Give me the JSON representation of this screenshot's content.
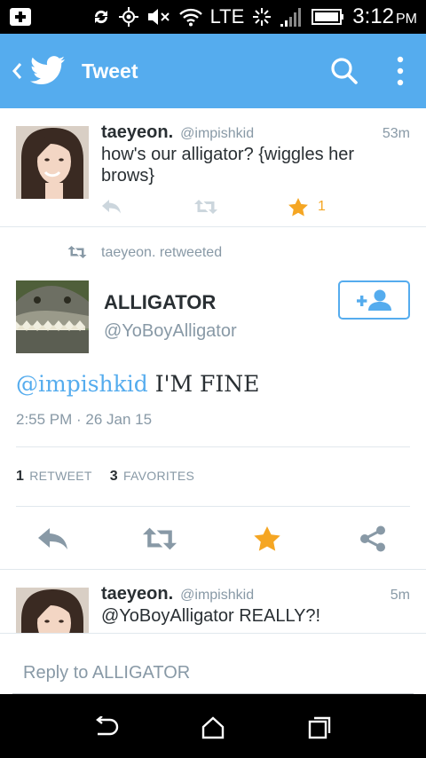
{
  "status_bar": {
    "network": "LTE",
    "time": "3:12",
    "ampm": "PM"
  },
  "app_bar": {
    "title": "Tweet",
    "icons": [
      "back-chevron-icon",
      "twitter-bird-icon",
      "search-icon",
      "overflow-menu-icon"
    ]
  },
  "tweets": {
    "t1": {
      "name": "taeyeon.",
      "handle": "@impishkid",
      "time": "53m",
      "text": "how's our alligator? {wiggles her brows}",
      "favorite_count": "1"
    },
    "main": {
      "retweeted_by": "taeyeon. retweeted",
      "name": "ALLIGATOR",
      "handle": "@YoBoyAlligator",
      "mention": "@impishkid",
      "text": " I'M FINE",
      "timestamp": "2:55 PM · 26 Jan 15",
      "retweets_count": "1",
      "retweets_label": "RETWEET",
      "favorites_count": "3",
      "favorites_label": "FAVORITES"
    },
    "t3": {
      "name": "taeyeon.",
      "handle": "@impishkid",
      "time": "5m",
      "text": "@YoBoyAlligator REALLY?!"
    }
  },
  "reply": {
    "placeholder": "Reply to ALLIGATOR",
    "value": ""
  },
  "colors": {
    "brand": "#55acee",
    "favorite": "#f5a623",
    "muted": "#8899a6",
    "text": "#292f33"
  }
}
